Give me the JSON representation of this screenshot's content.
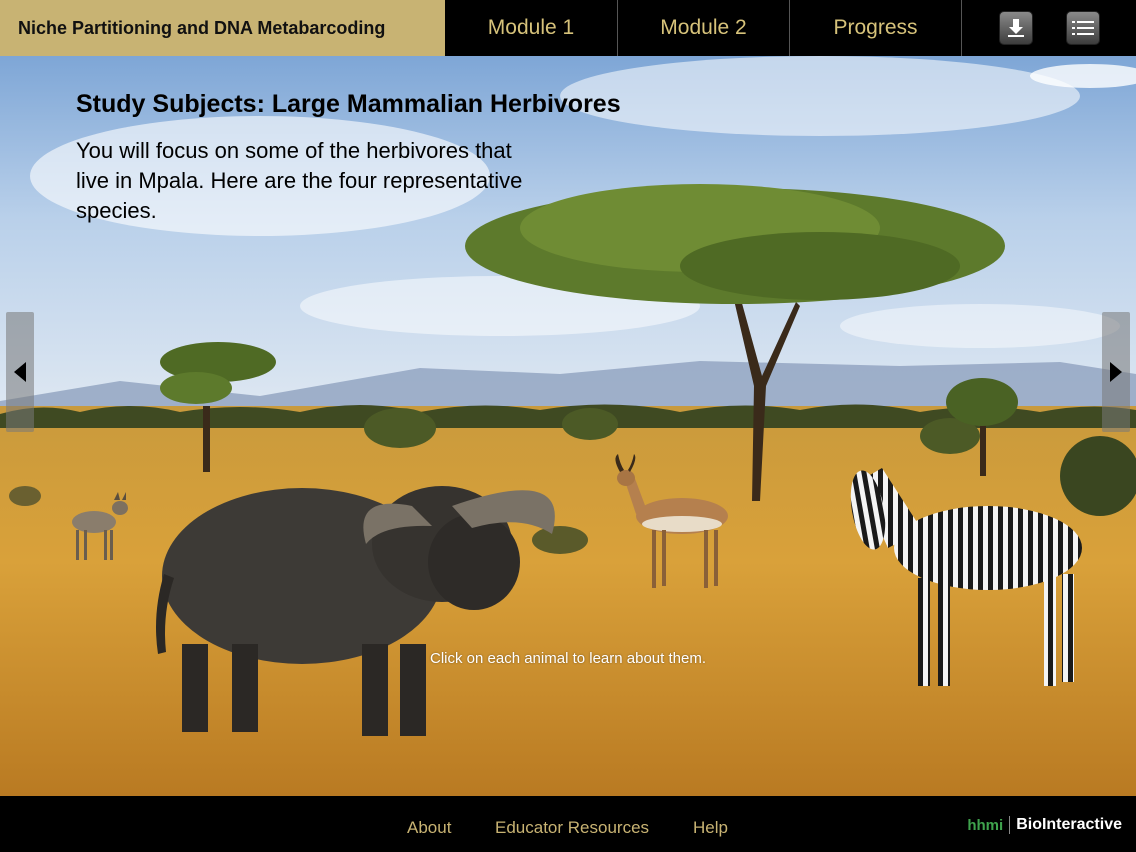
{
  "header": {
    "course_title": "Niche Partitioning and DNA Metabarcoding",
    "tabs": [
      {
        "label": "Module 1"
      },
      {
        "label": "Module 2"
      },
      {
        "label": "Progress"
      }
    ],
    "tools": {
      "download_icon": "download-icon",
      "menu_icon": "list-menu-icon"
    }
  },
  "content": {
    "heading": "Study Subjects: Large Mammalian Herbivores",
    "intro": "You will focus on some of the herbivores that live in Mpala. Here are the four representative species.",
    "hint": "Click on each animal to learn about them."
  },
  "nav": {
    "prev_icon": "triangle-left-icon",
    "next_icon": "triangle-right-icon"
  },
  "animals": [
    {
      "icon": "dik-dik-image"
    },
    {
      "icon": "buffalo-image"
    },
    {
      "icon": "impala-image"
    },
    {
      "icon": "zebra-image"
    }
  ],
  "footer": {
    "links": [
      {
        "label": "About"
      },
      {
        "label": "Educator Resources"
      },
      {
        "label": "Help"
      }
    ],
    "brand_primary": "hhmi",
    "brand_secondary": "BioInteractive"
  },
  "colors": {
    "accent_gold": "#c8b373",
    "nav_text": "#d6c27a",
    "brand_green": "#3fa34d"
  }
}
